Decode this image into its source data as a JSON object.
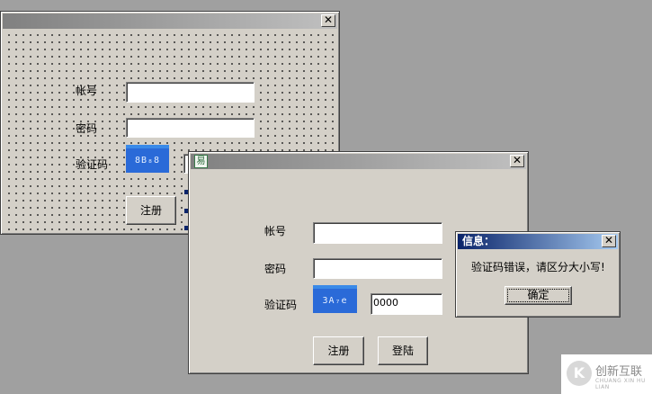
{
  "designer_window": {
    "title": "",
    "account_label": "帐号",
    "password_label": "密码",
    "captcha_label": "验证码",
    "captcha_text": "8B₈8",
    "register_label": "注册"
  },
  "login_window": {
    "title": "",
    "account_label": "帐号",
    "password_label": "密码",
    "captcha_label": "验证码",
    "captcha_text": "3A₇e",
    "captcha_input_value": "0000",
    "register_label": "注册",
    "login_label": "登陆"
  },
  "message_box": {
    "title": "信息：",
    "message": "验证码错误，请区分大小写!",
    "ok_label": "确定"
  },
  "watermark": {
    "brand": "创新互联",
    "sub": "CHUANG XIN HU LIAN"
  },
  "icons": {
    "close": "close-icon",
    "app": "app-icon"
  },
  "colors": {
    "desktop": "#a0a0a0",
    "window_face": "#d4d0c8",
    "active_title": "#0a246a",
    "captcha_bg": "#2a6ad8"
  }
}
